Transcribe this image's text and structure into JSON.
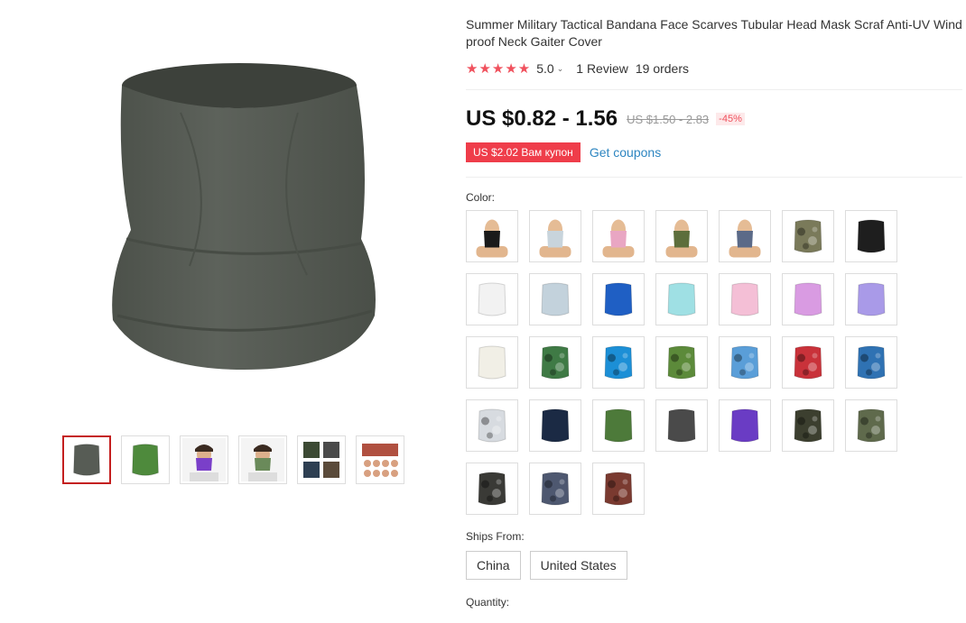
{
  "product": {
    "title": "Summer Military Tactical Bandana Face Scarves Tubular Head Mask Scraf Anti-UV Windproof Neck Gaiter Cover",
    "stars": "★★★★★",
    "rating": "5.0",
    "reviews": "1 Review",
    "orders": "19 orders"
  },
  "price": {
    "current": "US $0.82 - 1.56",
    "original": "US $1.50 - 2.83",
    "discount": "-45%"
  },
  "coupon": {
    "label": "US $2.02 Вам купон",
    "link": "Get coupons"
  },
  "color": {
    "label": "Color:",
    "swatches": [
      {
        "type": "model",
        "mask": "#1a1a1a"
      },
      {
        "type": "model",
        "mask": "#c8d4dc"
      },
      {
        "type": "model",
        "mask": "#e9a6c3"
      },
      {
        "type": "model",
        "mask": "#5d6e3c"
      },
      {
        "type": "model",
        "mask": "#5b6a88"
      },
      {
        "type": "gaiter",
        "color": "#7a7a5a",
        "pattern": "camo"
      },
      {
        "type": "gaiter",
        "color": "#1e1e1e"
      },
      {
        "type": "gaiter",
        "color": "#f2f2f2"
      },
      {
        "type": "gaiter",
        "color": "#c3d2dc"
      },
      {
        "type": "gaiter",
        "color": "#1f5fc4"
      },
      {
        "type": "gaiter",
        "color": "#9fe0e4"
      },
      {
        "type": "gaiter",
        "color": "#f4bfd6"
      },
      {
        "type": "gaiter",
        "color": "#d99be2"
      },
      {
        "type": "gaiter",
        "color": "#a99ae8"
      },
      {
        "type": "gaiter",
        "color": "#f1efe6"
      },
      {
        "type": "gaiter",
        "color": "#3f7a45",
        "pattern": "camo"
      },
      {
        "type": "gaiter",
        "color": "#1c8fd6",
        "pattern": "camo"
      },
      {
        "type": "gaiter",
        "color": "#5c8a3a",
        "pattern": "camo"
      },
      {
        "type": "gaiter",
        "color": "#5a9ed8",
        "pattern": "camo"
      },
      {
        "type": "gaiter",
        "color": "#c9323a",
        "pattern": "camo"
      },
      {
        "type": "gaiter",
        "color": "#2f72b3",
        "pattern": "camo"
      },
      {
        "type": "gaiter",
        "color": "#d7dbe0",
        "pattern": "camo"
      },
      {
        "type": "gaiter",
        "color": "#1b2a44"
      },
      {
        "type": "gaiter",
        "color": "#4d7a3a"
      },
      {
        "type": "gaiter",
        "color": "#4a4a4a"
      },
      {
        "type": "gaiter",
        "color": "#6a3cc4"
      },
      {
        "type": "gaiter",
        "color": "#3c3f2f",
        "pattern": "camo"
      },
      {
        "type": "gaiter",
        "color": "#5f6a4c",
        "pattern": "camo"
      },
      {
        "type": "gaiter",
        "color": "#3a3a36",
        "pattern": "camo"
      },
      {
        "type": "gaiter",
        "color": "#4e5870",
        "pattern": "camo"
      },
      {
        "type": "gaiter",
        "color": "#7a3a30",
        "pattern": "camo"
      }
    ]
  },
  "ships": {
    "label": "Ships From:",
    "options": [
      "China",
      "United States"
    ]
  },
  "quantity": {
    "label": "Quantity:"
  },
  "gallery": {
    "main_color": "#575c55",
    "thumbs": [
      {
        "kind": "gaiter",
        "color": "#575c55",
        "active": true
      },
      {
        "kind": "gaiter",
        "color": "#4e8a3c",
        "active": false
      },
      {
        "kind": "person",
        "color": "#7a3fc9",
        "active": false
      },
      {
        "kind": "person",
        "color": "#6a8a5a",
        "active": false
      },
      {
        "kind": "collection",
        "color": "#555",
        "active": false
      },
      {
        "kind": "collage",
        "color": "#b05040",
        "active": false
      }
    ]
  }
}
